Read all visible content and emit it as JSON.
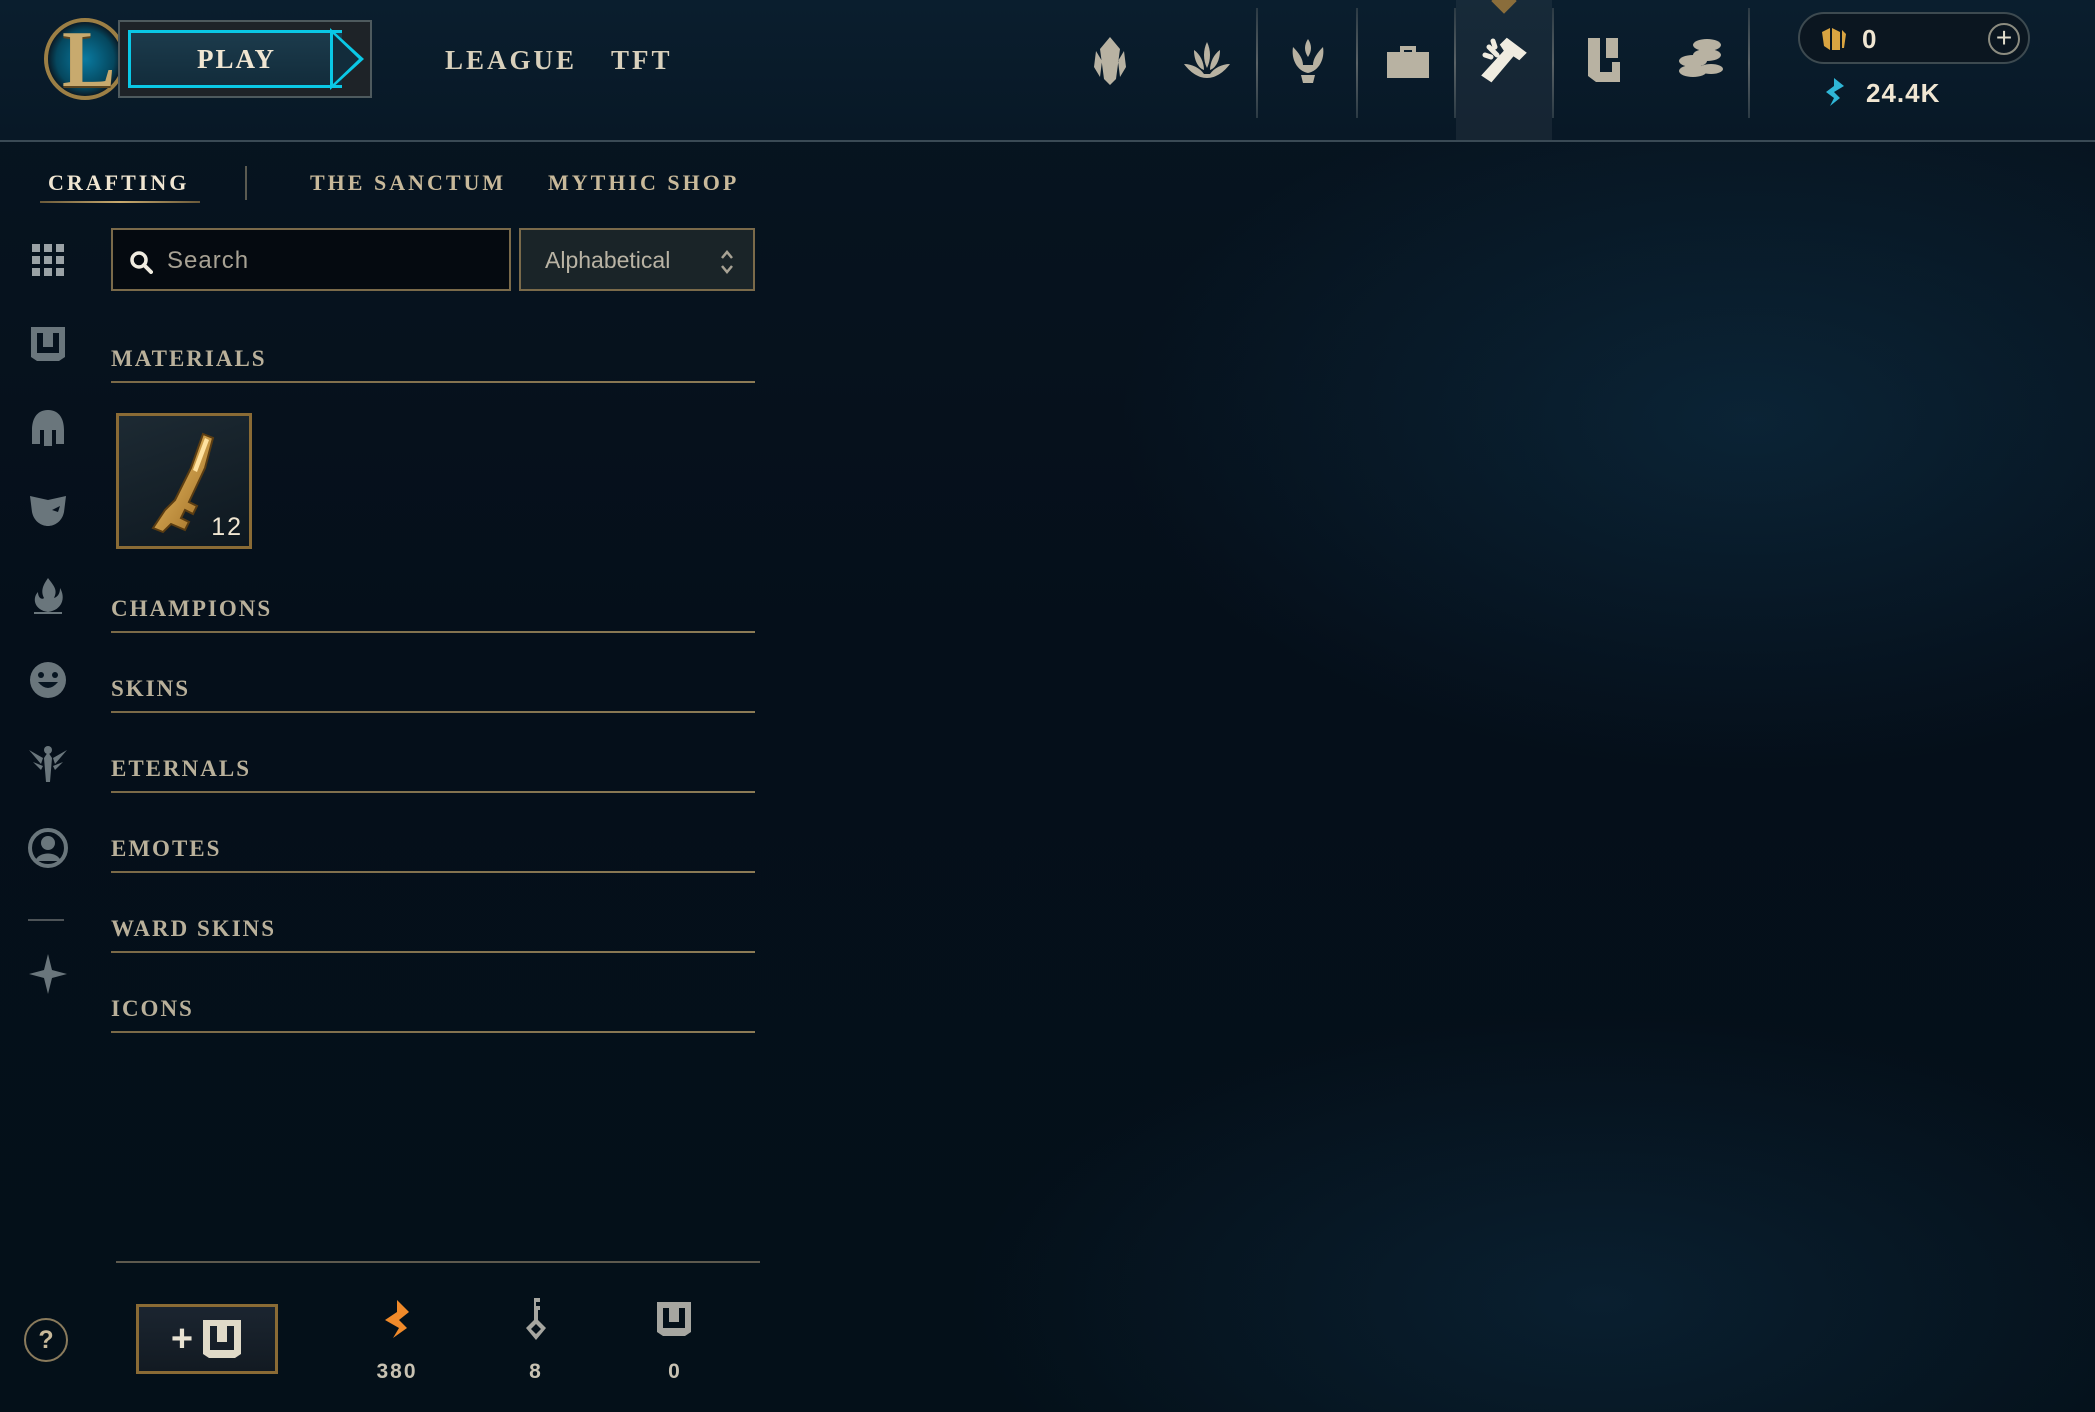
{
  "header": {
    "play_label": "PLAY",
    "nav": [
      {
        "label": "LEAGUE"
      },
      {
        "label": "TFT"
      }
    ],
    "icons": [
      "profile-icon",
      "collection-icon",
      "loot-icon",
      "store-icon",
      "crafting-icon",
      "chest-icon",
      "coins-icon"
    ],
    "currency": {
      "rp": "0",
      "blue_essence": "24.4K",
      "add_symbol": "+"
    }
  },
  "subtabs": [
    {
      "label": "CRAFTING",
      "active": true
    },
    {
      "label": "THE SANCTUM",
      "active": false
    },
    {
      "label": "MYTHIC SHOP",
      "active": false
    }
  ],
  "search": {
    "placeholder": "Search",
    "value": ""
  },
  "sort": {
    "selected": "Alphabetical"
  },
  "categories": {
    "materials": "MATERIALS",
    "champions": "CHAMPIONS",
    "skins": "SKINS",
    "eternals": "ETERNALS",
    "emotes": "EMOTES",
    "ward_skins": "WARD SKINS",
    "icons": "ICONS"
  },
  "materials": [
    {
      "name": "key-fragment",
      "count": "12"
    }
  ],
  "footer": {
    "help_label": "?",
    "add_label": "+",
    "stats": [
      {
        "icon": "orange-essence-icon",
        "value": "380"
      },
      {
        "icon": "key-icon",
        "value": "8"
      },
      {
        "icon": "chest-icon",
        "value": "0"
      }
    ]
  },
  "colors": {
    "gold": "#c8aa6e",
    "teal": "#0ac8e6",
    "text": "#f0e6d2",
    "bg": "#050f1a",
    "orange": "#f08a2a"
  }
}
